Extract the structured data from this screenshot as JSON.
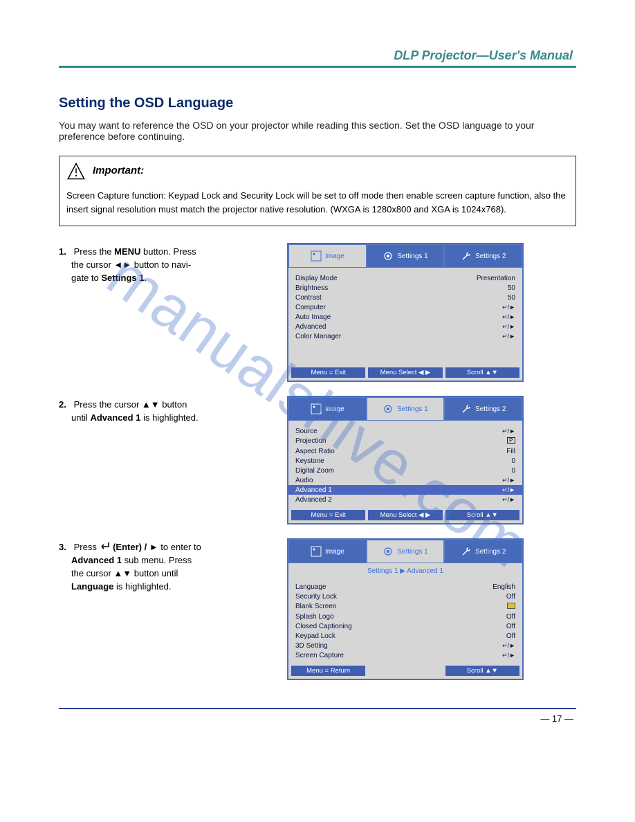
{
  "header": {
    "title": "DLP Projector—User's Manual"
  },
  "section": {
    "heading": "Setting the OSD Language",
    "intro": "You may want to reference the OSD on your projector while reading this section. Set the OSD language to your preference before continuing."
  },
  "important": {
    "label": "Important:",
    "text": "Screen Capture function: Keypad Lock and Security Lock will be set to off mode then enable screen capture function, also the insert signal resolution must match the projector native resolution. (WXGA is 1280x800 and XGA is 1024x768)."
  },
  "steps": {
    "s1": {
      "num": "1.",
      "line1_a": "Press the ",
      "line1_key": "MENU",
      "line1_b": " button. Press",
      "line2": "the cursor ◄► button to navi-",
      "line3_a": "gate to ",
      "line3_key": "Settings 1",
      "line3_b": "."
    },
    "s2": {
      "num": "2.",
      "line1": "Press the cursor ▲▼ button",
      "line2_a": "until ",
      "line2_key": "Advanced 1",
      "line2_b": " is highlighted."
    },
    "s3": {
      "num": "3.",
      "line1": "Press ",
      "line1_key": "(Enter) / ►",
      "line1_b": " to enter to",
      "line2_key": "Advanced 1",
      "line2_b": " sub menu. Press",
      "line3": "the cursor ▲▼ button until",
      "line4_key": "Language",
      "line4_b": " is highlighted."
    }
  },
  "osd1": {
    "tabs": {
      "image": "Image",
      "settings1": "Settings 1",
      "settings2": "Settings 2"
    },
    "items": [
      {
        "label": "Display Mode",
        "value": "Presentation"
      },
      {
        "label": "Brightness",
        "value": "50"
      },
      {
        "label": "Contrast",
        "value": "50"
      },
      {
        "label": "Computer",
        "value": "↵/►"
      },
      {
        "label": "Auto Image",
        "value": "↵/►"
      },
      {
        "label": "Advanced",
        "value": "↵/►"
      },
      {
        "label": "Color Manager",
        "value": "↵/►"
      }
    ],
    "footer": {
      "exit": "Menu = Exit",
      "select": "Menu Select ◀ ▶",
      "scroll": "Scroll ▲▼"
    }
  },
  "osd2": {
    "tabs": {
      "image": "Image",
      "settings1": "Settings 1",
      "settings2": "Settings 2"
    },
    "items": [
      {
        "label": "Source",
        "value": "↵/►"
      },
      {
        "label": "Projection",
        "value": "P"
      },
      {
        "label": "Aspect Ratio",
        "value": "Fill"
      },
      {
        "label": "Keystone",
        "value": "0"
      },
      {
        "label": "Digital Zoom",
        "value": "0"
      },
      {
        "label": "Audio",
        "value": "↵/►"
      },
      {
        "label": "Advanced 1",
        "value": "↵/►",
        "hl": true
      },
      {
        "label": "Advanced 2",
        "value": "↵/►"
      }
    ],
    "footer": {
      "exit": "Menu = Exit",
      "select": "Menu Select ◀ ▶",
      "scroll": "Scroll ▲▼"
    }
  },
  "osd3": {
    "tabs": {
      "image": "Image",
      "settings1": "Settings 1",
      "settings2": "Settings 2"
    },
    "breadcrumb": "Settings 1 ▶ Advanced 1",
    "items": [
      {
        "label": "Language",
        "value": "English"
      },
      {
        "label": "Security Lock",
        "value": "Off"
      },
      {
        "label": "Blank Screen",
        "value": "■"
      },
      {
        "label": "Splash Logo",
        "value": "Off"
      },
      {
        "label": "Closed Captioning",
        "value": "Off"
      },
      {
        "label": "Keypad Lock",
        "value": "Off"
      },
      {
        "label": "3D Setting",
        "value": "↵/►"
      },
      {
        "label": "Screen Capture",
        "value": "↵/►"
      }
    ],
    "footer": {
      "ret": "Menu = Return",
      "scroll": "Scroll ▲▼"
    }
  },
  "pagenum": "— 17 —",
  "watermark": "manualshive.com"
}
